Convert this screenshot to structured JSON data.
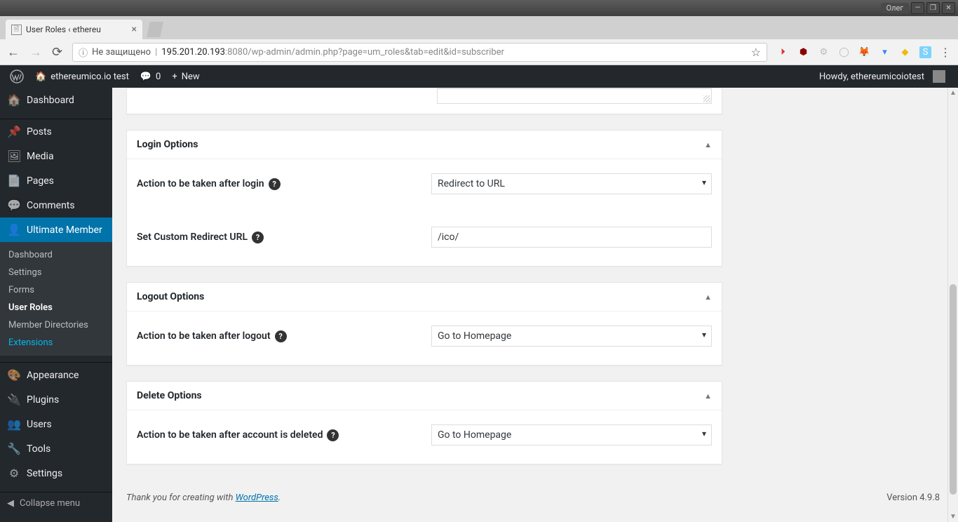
{
  "os": {
    "user": "Олег"
  },
  "browser": {
    "tab_title": "User Roles ‹ ethereu",
    "insecure_label": "Не защищено",
    "url_host": "195.201.20.193",
    "url_port_path": ":8080/wp-admin/admin.php?page=um_roles&tab=edit&id=subscriber"
  },
  "adminbar": {
    "site_name": "ethereumico.io test",
    "comments_count": "0",
    "new_label": "New",
    "howdy": "Howdy, ethereumicoiotest"
  },
  "sidebar": {
    "items": [
      {
        "icon": "🏠",
        "label": "Dashboard"
      },
      {
        "icon": "📌",
        "label": "Posts"
      },
      {
        "icon": "🖼",
        "label": "Media"
      },
      {
        "icon": "📄",
        "label": "Pages"
      },
      {
        "icon": "💬",
        "label": "Comments"
      },
      {
        "icon": "👤",
        "label": "Ultimate Member"
      },
      {
        "icon": "🎨",
        "label": "Appearance"
      },
      {
        "icon": "🔌",
        "label": "Plugins"
      },
      {
        "icon": "👥",
        "label": "Users"
      },
      {
        "icon": "🔧",
        "label": "Tools"
      },
      {
        "icon": "⚙",
        "label": "Settings"
      }
    ],
    "submenu": [
      {
        "label": "Dashboard"
      },
      {
        "label": "Settings"
      },
      {
        "label": "Forms"
      },
      {
        "label": "User Roles"
      },
      {
        "label": "Member Directories"
      },
      {
        "label": "Extensions"
      }
    ],
    "collapse": "Collapse menu"
  },
  "boxes": {
    "login": {
      "title": "Login Options",
      "action_label": "Action to be taken after login",
      "action_value": "Redirect to URL",
      "redirect_label": "Set Custom Redirect URL",
      "redirect_value": "/ico/"
    },
    "logout": {
      "title": "Logout Options",
      "action_label": "Action to be taken after logout",
      "action_value": "Go to Homepage"
    },
    "delete": {
      "title": "Delete Options",
      "action_label": "Action to be taken after account is deleted",
      "action_value": "Go to Homepage"
    }
  },
  "footer": {
    "thanks_prefix": "Thank you for creating with ",
    "wp_link": "WordPress",
    "period": ".",
    "version": "Version 4.9.8"
  }
}
